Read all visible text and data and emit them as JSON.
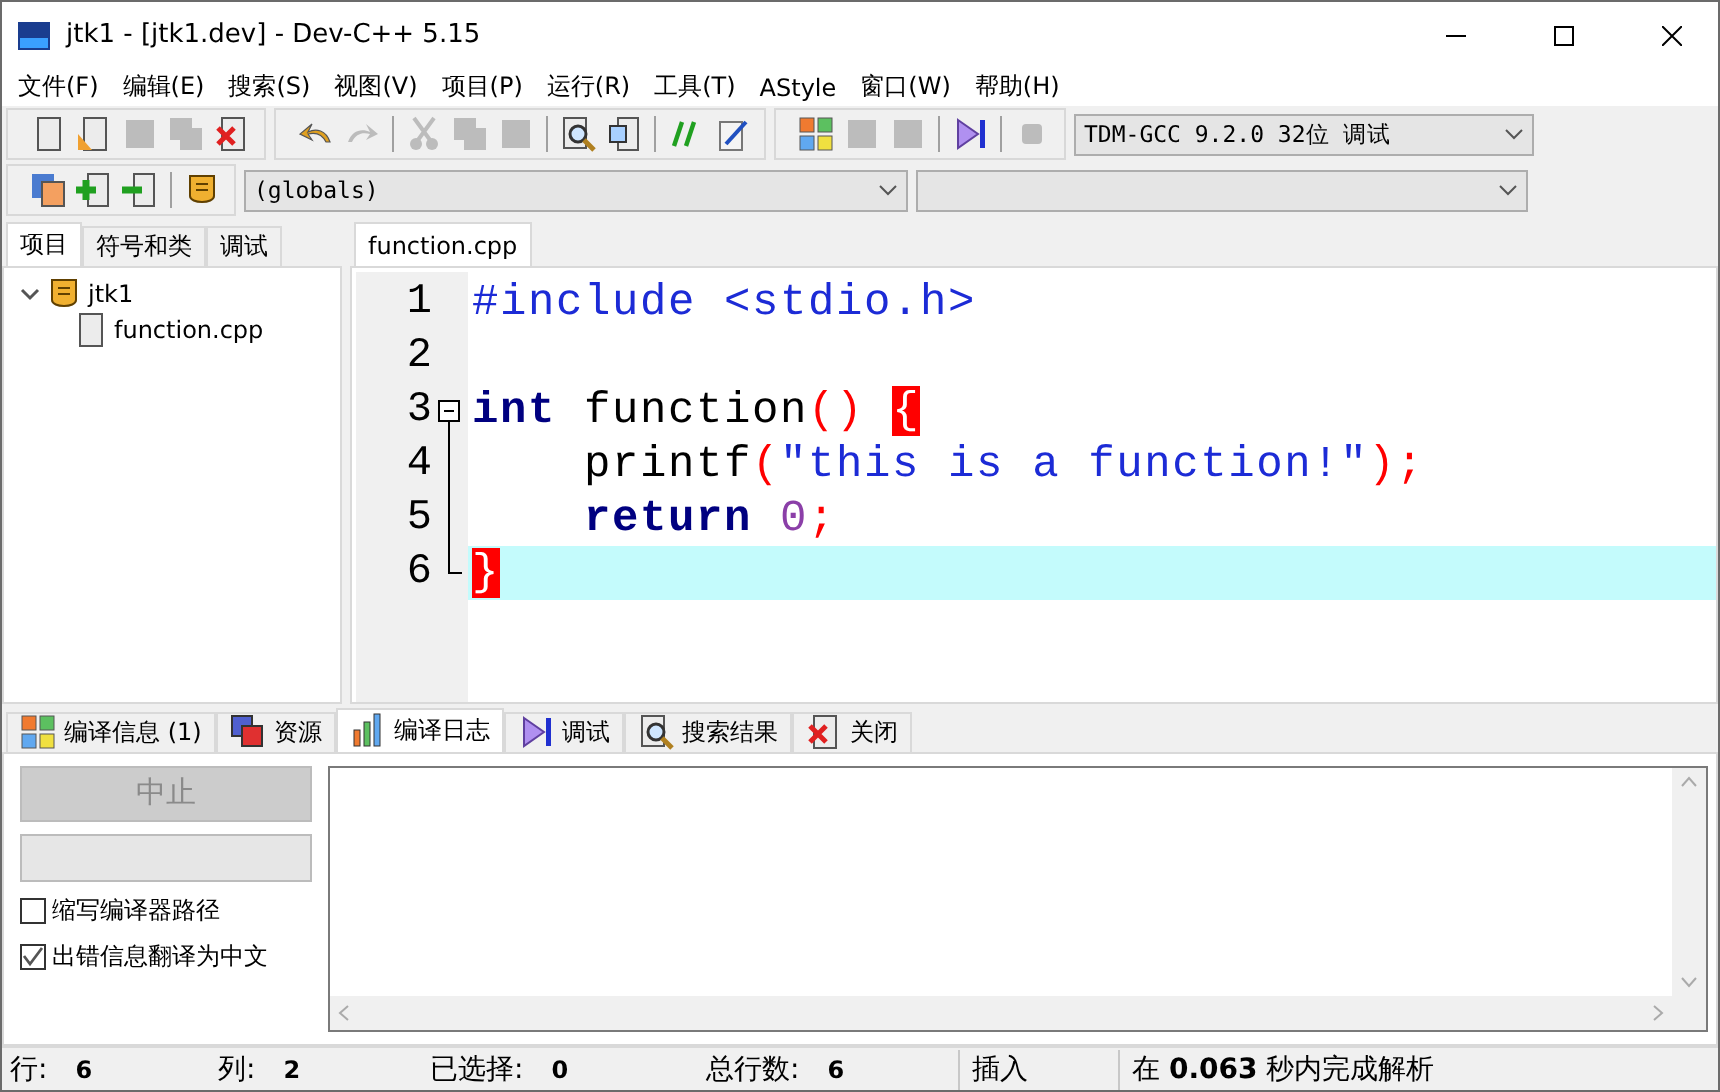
{
  "window": {
    "title": "jtk1 - [jtk1.dev] - Dev-C++ 5.15"
  },
  "menu": [
    "文件(F)",
    "编辑(E)",
    "搜索(S)",
    "视图(V)",
    "项目(P)",
    "运行(R)",
    "工具(T)",
    "AStyle",
    "窗口(W)",
    "帮助(H)"
  ],
  "toolbar_rows": [
    {
      "groups": [
        {
          "buttons": [
            {
              "kind": "new",
              "disabled": false
            },
            {
              "kind": "open",
              "disabled": false
            },
            {
              "kind": "save",
              "disabled": true
            },
            {
              "kind": "save-all",
              "disabled": true
            },
            {
              "kind": "close",
              "disabled": false
            }
          ]
        },
        {
          "buttons": [
            {
              "kind": "undo",
              "disabled": false
            },
            {
              "kind": "redo",
              "disabled": true
            },
            {
              "kind": "sep"
            },
            {
              "kind": "cut",
              "disabled": true
            },
            {
              "kind": "copy",
              "disabled": true
            },
            {
              "kind": "paste",
              "disabled": true
            },
            {
              "kind": "sep"
            },
            {
              "kind": "find",
              "disabled": false
            },
            {
              "kind": "window",
              "disabled": false
            },
            {
              "kind": "sep"
            },
            {
              "kind": "comment",
              "disabled": false
            },
            {
              "kind": "note",
              "disabled": false
            }
          ]
        },
        {
          "buttons": [
            {
              "kind": "grid",
              "disabled": false
            },
            {
              "kind": "square",
              "disabled": true
            },
            {
              "kind": "square",
              "disabled": true
            },
            {
              "kind": "sep"
            },
            {
              "kind": "debug",
              "disabled": false
            },
            {
              "kind": "sep"
            },
            {
              "kind": "stop",
              "disabled": true
            }
          ]
        }
      ],
      "dropdowns": [
        {
          "value": "TDM-GCC 9.2.0 32位 调试",
          "kind": "compiler"
        }
      ]
    },
    {
      "groups": [
        {
          "buttons": [
            {
              "kind": "project",
              "disabled": false
            },
            {
              "kind": "add",
              "disabled": false
            },
            {
              "kind": "remove",
              "disabled": false
            },
            {
              "kind": "sep"
            },
            {
              "kind": "class",
              "disabled": false
            }
          ]
        }
      ],
      "dropdowns": [
        {
          "value": "(globals)",
          "kind": "scope"
        },
        {
          "kind": "member"
        }
      ]
    }
  ],
  "side_tabs": [
    {
      "label": "项目",
      "selected": true
    },
    {
      "label": "符号和类",
      "selected": false
    },
    {
      "label": "调试",
      "selected": false
    }
  ],
  "project_tree": [
    {
      "label": "jtk1",
      "kind": "project",
      "expanded": true,
      "children": [
        {
          "label": "function.cpp",
          "kind": "file"
        }
      ]
    }
  ],
  "editor_tabs": [
    {
      "label": "function.cpp",
      "selected": true
    }
  ],
  "code_lines": [
    {
      "number": "1",
      "current": false,
      "kind": "plain",
      "tokens": [
        {
          "kind": "preproc",
          "text": "#include <stdio.h>"
        }
      ]
    },
    {
      "number": "2",
      "current": false,
      "kind": "plain"
    },
    {
      "number": "3",
      "current": false,
      "kind": "fold-start",
      "tokens": [
        {
          "kind": "keyword",
          "text": "int"
        },
        {
          "kind": "plain",
          "text": " function"
        },
        {
          "kind": "punct",
          "text": "() "
        },
        {
          "kind": "brace-match",
          "text": "{"
        }
      ]
    },
    {
      "number": "4",
      "current": false,
      "kind": "fold-body",
      "tokens": [
        {
          "kind": "plain",
          "text": "    printf"
        },
        {
          "kind": "punct",
          "text": "("
        },
        {
          "kind": "string",
          "text": "\"this is a function!\""
        },
        {
          "kind": "punct",
          "text": ");"
        }
      ]
    },
    {
      "number": "5",
      "current": false,
      "kind": "fold-body",
      "tokens": [
        {
          "kind": "keyword",
          "text": "    return "
        },
        {
          "kind": "number",
          "text": "0"
        },
        {
          "kind": "punct",
          "text": ";"
        }
      ]
    },
    {
      "number": "6",
      "current": true,
      "kind": "fold-end",
      "tokens": [
        {
          "kind": "brace-match",
          "text": "}"
        }
      ]
    }
  ],
  "bottom_tabs": [
    {
      "label": "编译信息 (1)",
      "kind": "grid",
      "selected": false
    },
    {
      "label": "资源",
      "kind": "resources",
      "selected": false
    },
    {
      "label": "编译日志",
      "kind": "chart",
      "selected": true
    },
    {
      "label": "调试",
      "kind": "debug",
      "selected": false
    },
    {
      "label": "搜索结果",
      "kind": "find",
      "selected": false
    },
    {
      "label": "关闭",
      "kind": "close",
      "selected": false
    }
  ],
  "compile_log": {
    "abort_button": {
      "label": "中止",
      "disabled": true
    },
    "progress": {
      "level": 0
    },
    "options": [
      {
        "label": "缩写编译器路径",
        "checked": false
      },
      {
        "label": "出错信息翻译为中文",
        "checked": true
      }
    ]
  },
  "status_bar": {
    "fields": [
      {
        "label": "行:",
        "value": "6"
      },
      {
        "label": "列:",
        "value": "2"
      },
      {
        "label": "已选择:",
        "value": "0"
      },
      {
        "label": "总行数:",
        "value": "6"
      }
    ],
    "mode": "插入",
    "message": "在 **0.063** 秒内完成解析"
  }
}
